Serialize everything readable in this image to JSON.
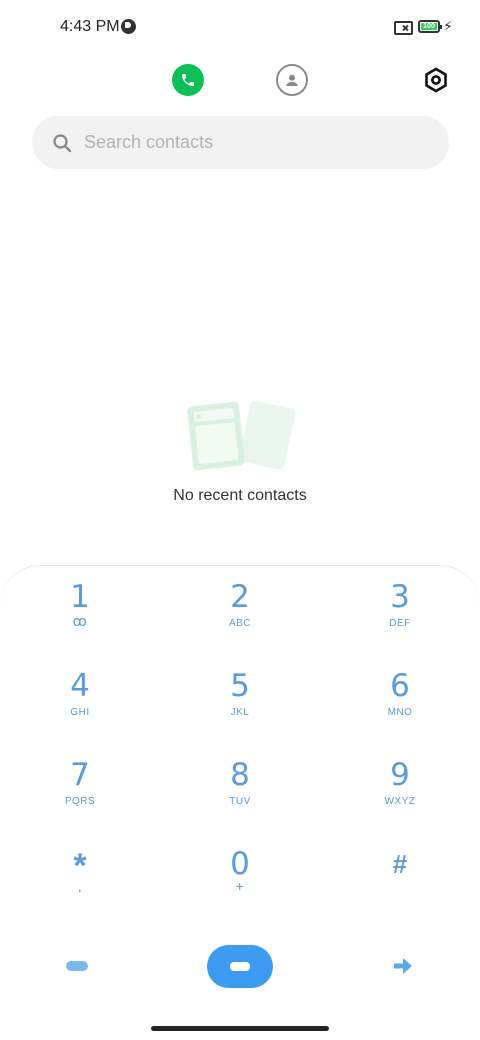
{
  "status_bar": {
    "time": "4:43 PM",
    "battery_level": "100",
    "icons": [
      "app-notification-icon",
      "no-sim-icon",
      "battery-icon",
      "charging-icon"
    ]
  },
  "top_nav": {
    "tabs": [
      {
        "name": "phone-icon",
        "active": true,
        "color": "#0dbf57"
      },
      {
        "name": "contacts-icon",
        "active": false
      }
    ],
    "settings_icon": "settings-icon"
  },
  "search": {
    "placeholder": "Search contacts",
    "value": ""
  },
  "empty_state": {
    "message": "No recent contacts"
  },
  "dialpad": {
    "keys": [
      {
        "digit": "1",
        "letters": "ꝏ"
      },
      {
        "digit": "2",
        "letters": "ABC"
      },
      {
        "digit": "3",
        "letters": "DEF"
      },
      {
        "digit": "4",
        "letters": "GHI"
      },
      {
        "digit": "5",
        "letters": "JKL"
      },
      {
        "digit": "6",
        "letters": "MNO"
      },
      {
        "digit": "7",
        "letters": "PQRS"
      },
      {
        "digit": "8",
        "letters": "TUV"
      },
      {
        "digit": "9",
        "letters": "WXYZ"
      },
      {
        "digit": "*",
        "letters": ","
      },
      {
        "digit": "0",
        "letters": "+"
      },
      {
        "digit": "#",
        "letters": ""
      }
    ],
    "accent_color": "#5c9bd6",
    "dial_button_color": "#3d9cf2"
  }
}
